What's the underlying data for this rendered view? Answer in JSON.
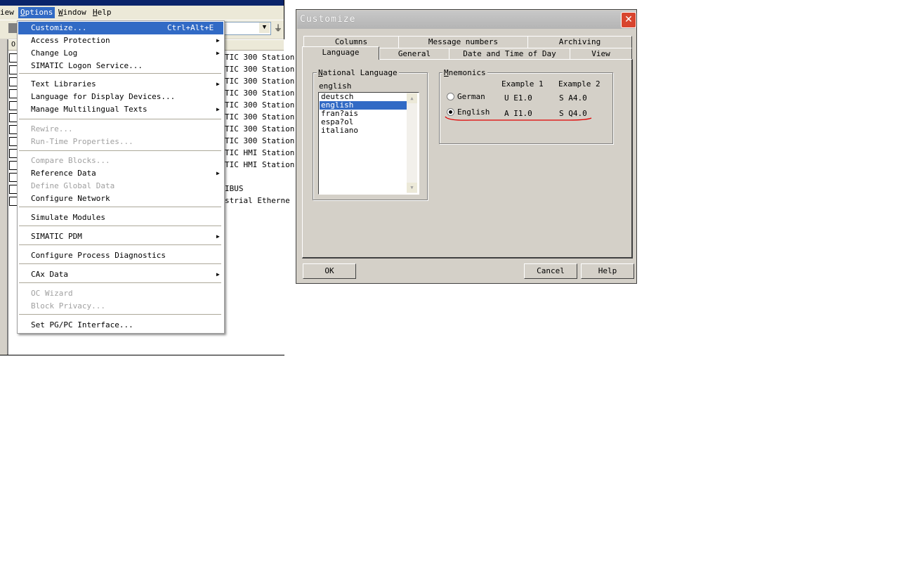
{
  "menubar": {
    "partial_label": "iew",
    "items": [
      "Options",
      "Window",
      "Help"
    ]
  },
  "list_header": "O",
  "station_rows": [
    "TIC 300 Station",
    "TIC 300 Station",
    "TIC 300 Station",
    "TIC 300 Station",
    "TIC 300 Station",
    "TIC 300 Station",
    "TIC 300 Station",
    "TIC 300 Station",
    "TIC HMI Station",
    "TIC HMI Station",
    "",
    "IBUS",
    "strial Etherne"
  ],
  "options_menu": {
    "items": [
      {
        "label": "Customize...",
        "shortcut": "Ctrl+Alt+E",
        "selected": true
      },
      {
        "label": "Access Protection",
        "submenu": true
      },
      {
        "label": "Change Log",
        "submenu": true
      },
      {
        "label": "SIMATIC Logon Service..."
      },
      {
        "label": "Text Libraries",
        "submenu": true
      },
      {
        "label": "Language for Display Devices..."
      },
      {
        "label": "Manage Multilingual Texts",
        "submenu": true
      },
      {
        "label": "Rewire...",
        "disabled": true
      },
      {
        "label": "Run-Time Properties...",
        "disabled": true
      },
      {
        "label": "Compare Blocks...",
        "disabled": true
      },
      {
        "label": "Reference Data",
        "submenu": true
      },
      {
        "label": "Define Global Data",
        "disabled": true
      },
      {
        "label": "Configure Network"
      },
      {
        "label": "Simulate Modules"
      },
      {
        "label": "SIMATIC PDM",
        "submenu": true
      },
      {
        "label": "Configure Process Diagnostics"
      },
      {
        "label": "CAx Data",
        "submenu": true
      },
      {
        "label": "OC Wizard",
        "disabled": true
      },
      {
        "label": "Block Privacy...",
        "disabled": true
      },
      {
        "label": "Set PG/PC Interface..."
      }
    ]
  },
  "dialog": {
    "title": "Customize",
    "tabs_back": [
      "Columns",
      "Message numbers",
      "Archiving"
    ],
    "tabs_front": [
      "Language",
      "General",
      "Date and Time of Day",
      "View"
    ],
    "active_tab": "Language",
    "national_language": {
      "label": "National Language",
      "current": "english",
      "options": [
        "deutsch",
        "english",
        "fran?ais",
        "espa?ol",
        "italiano"
      ],
      "selected": "english"
    },
    "mnemonics": {
      "label": "Mnemonics",
      "col1": "Example 1",
      "col2": "Example 2",
      "rows": [
        {
          "name": "German",
          "ex1": "U E1.0",
          "ex2": "S A4.0",
          "checked": false
        },
        {
          "name": "English",
          "ex1": "A I1.0",
          "ex2": "S Q4.0",
          "checked": true
        }
      ]
    },
    "buttons": {
      "ok": "OK",
      "cancel": "Cancel",
      "help": "Help"
    }
  },
  "colors": {
    "selection": "#316ac5",
    "annotation": "#e00000",
    "dialog_bg": "#d4d0c8"
  }
}
